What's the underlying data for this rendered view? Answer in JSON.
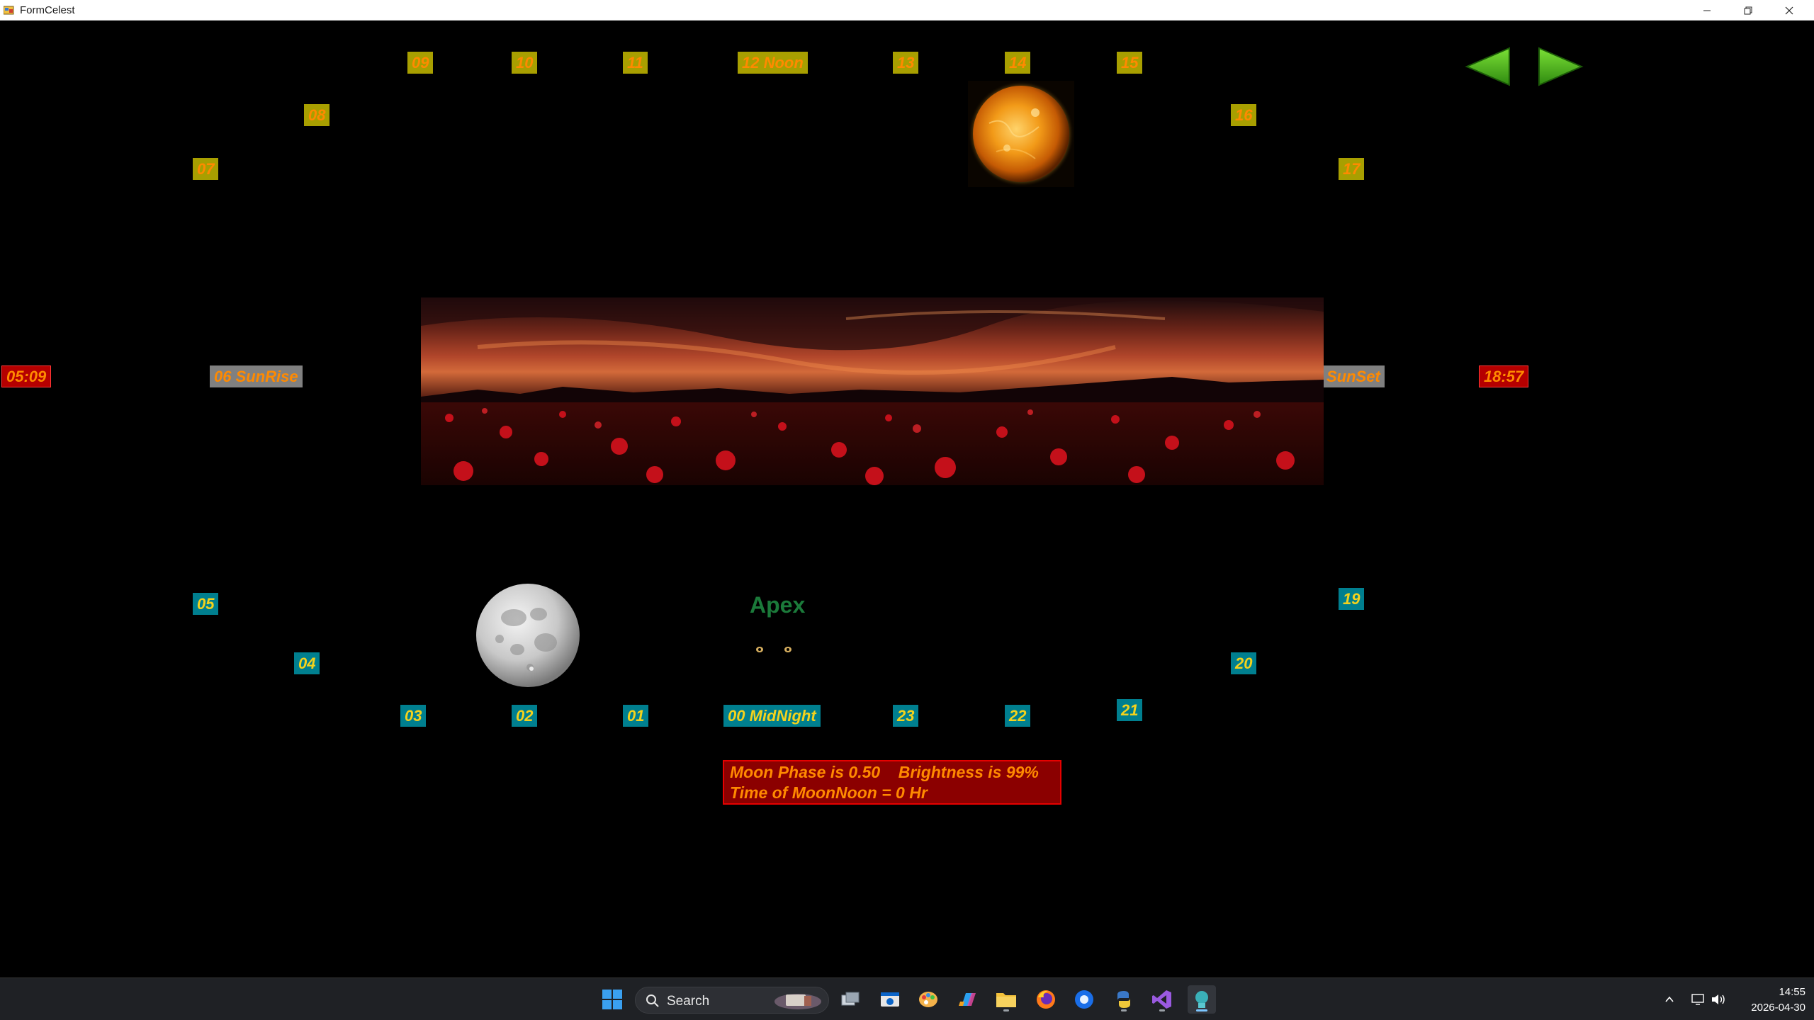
{
  "window": {
    "title": "FormCelest"
  },
  "hours_day": {
    "h07": "07",
    "h08": "08",
    "h09": "09",
    "h10": "10",
    "h11": "11",
    "h12": "12 Noon",
    "h13": "13",
    "h14": "14",
    "h15": "15",
    "h16": "16",
    "h17": "17"
  },
  "hours_night": {
    "h05": "05",
    "h04": "04",
    "h03": "03",
    "h02": "02",
    "h01": "01",
    "h00": "00 MidNight",
    "h23": "23",
    "h22": "22",
    "h21": "21",
    "h20": "20",
    "h19": "19"
  },
  "horizon": {
    "sunrise_label": "06 SunRise",
    "sunrise_time": "05:09",
    "sunset_label": "SunSet",
    "sunset_time": "18:57"
  },
  "apex_label": "Apex",
  "info": {
    "line1": "Moon Phase is 0.50    Brightness is 99%",
    "line2": "Time of MoonNoon = 0 Hr"
  },
  "navigation": {
    "prev_icon": "left-arrow-icon",
    "next_icon": "right-arrow-icon"
  },
  "taskbar": {
    "search_placeholder": "Search",
    "clock_time": "14:55",
    "clock_date": "2026-04-30",
    "apps": [
      "start-icon",
      "task-view-icon",
      "outlook-icon",
      "paint-icon",
      "copilot-icon",
      "file-explorer-icon",
      "firefox-icon",
      "browser-icon",
      "python-icon",
      "visual-studio-icon",
      "celest-app-icon"
    ]
  },
  "colors": {
    "day_bg": "#a89f00",
    "day_text": "#ff8a00",
    "night_bg": "#007f8f",
    "night_text": "#f4d21c",
    "info_bg": "#8b0000",
    "info_text": "#ff8a00"
  }
}
